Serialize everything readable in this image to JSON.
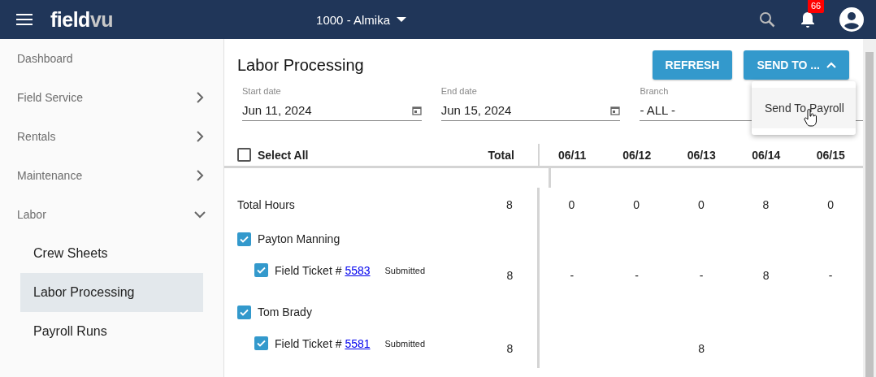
{
  "top_bar": {
    "logo": {
      "main": "field",
      "accent": "vu"
    },
    "company_selector": "1000 - Almika",
    "notification_count": "66"
  },
  "sidebar": {
    "items": [
      {
        "kind": "link",
        "label": "Dashboard"
      },
      {
        "kind": "group",
        "label": "Field Service",
        "expanded": false
      },
      {
        "kind": "group",
        "label": "Rentals",
        "expanded": false
      },
      {
        "kind": "group",
        "label": "Maintenance",
        "expanded": false
      },
      {
        "kind": "group",
        "label": "Labor",
        "expanded": true,
        "children": [
          {
            "label": "Crew Sheets",
            "selected": false
          },
          {
            "label": "Labor Processing",
            "selected": true
          },
          {
            "label": "Payroll Runs",
            "selected": false
          }
        ]
      }
    ]
  },
  "page": {
    "title": "Labor Processing",
    "buttons": [
      {
        "kind": "button",
        "label": "REFRESH"
      },
      {
        "kind": "menu",
        "label": "SEND TO ...",
        "expanded": true
      }
    ],
    "menu": {
      "items": [
        {
          "label": "Send To Payroll"
        }
      ]
    },
    "filters": [
      {
        "kind": "date",
        "label": "Start date",
        "value": "Jun 11, 2024"
      },
      {
        "kind": "date",
        "label": "End date",
        "value": "Jun 15, 2024"
      },
      {
        "kind": "select",
        "label": "Branch",
        "value": "- ALL -"
      }
    ]
  },
  "table": {
    "select_all": {
      "label": "Select All",
      "checked": false
    },
    "columns": [
      "Total",
      "06/11",
      "06/12",
      "06/13",
      "06/14",
      "06/15"
    ],
    "rows": [
      {
        "kind": "total",
        "label": "Total Hours",
        "total": "8",
        "days": {
          "day_1": "0",
          "day_2": "0",
          "day_3": "0",
          "day_4": "8",
          "day_5": "0"
        }
      },
      {
        "kind": "employee",
        "name": "Payton Manning",
        "checked": true
      },
      {
        "kind": "ticket",
        "label": "Field Ticket #",
        "number": "5583",
        "status": "Submitted",
        "checked": true,
        "total": "8",
        "days": {
          "day_1": "-",
          "day_2": "-",
          "day_3": "-",
          "day_4": "8",
          "day_5": "-"
        }
      },
      {
        "kind": "employee",
        "name": "Tom Brady",
        "checked": true
      },
      {
        "kind": "ticket",
        "label": "Field Ticket #",
        "number": "5581",
        "status": "Submitted",
        "checked": true,
        "total": "8",
        "days": {
          "day_3": "8"
        }
      }
    ]
  }
}
